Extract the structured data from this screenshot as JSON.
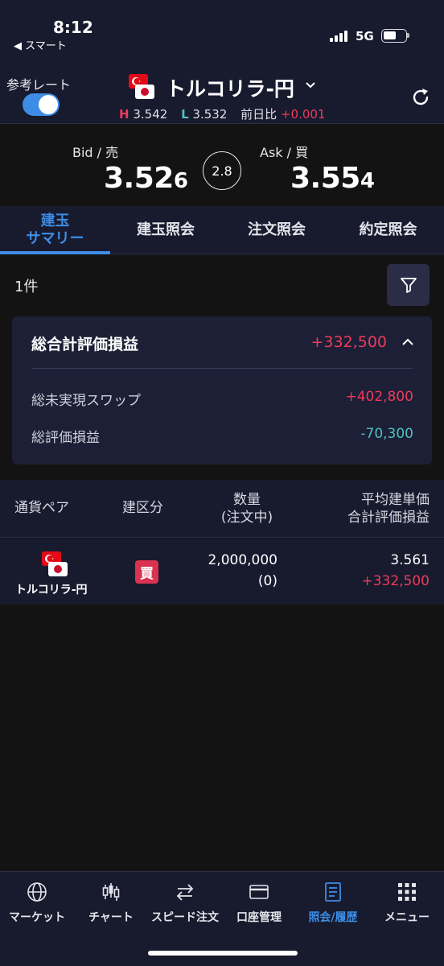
{
  "status_bar": {
    "time": "8:12",
    "back_app": "◀ スマート",
    "network": "5G"
  },
  "header": {
    "ref_rate_label": "参考レート",
    "ref_rate_enabled": true,
    "pair_name": "トルコリラ-円",
    "high_label": "H",
    "high_value": "3.542",
    "low_label": "L",
    "low_value": "3.532",
    "change_label": "前日比",
    "change_value": "+0.001"
  },
  "prices": {
    "bid_label": "Bid / 売",
    "bid_main": "3.52",
    "bid_pip": "6",
    "spread": "2.8",
    "ask_label": "Ask / 買",
    "ask_main": "3.55",
    "ask_pip": "4"
  },
  "tabs": [
    {
      "label": "建玉\nサマリー",
      "active": true
    },
    {
      "label": "建玉照会",
      "active": false
    },
    {
      "label": "注文照会",
      "active": false
    },
    {
      "label": "約定照会",
      "active": false
    }
  ],
  "summary": {
    "count": "1件",
    "title": "総合計評価損益",
    "total": "+332,500",
    "rows": [
      {
        "label": "総未実現スワップ",
        "value": "+402,800",
        "sign": "pos"
      },
      {
        "label": "総評価損益",
        "value": "-70,300",
        "sign": "neg"
      }
    ]
  },
  "table": {
    "headers": {
      "pair": "通貨ペア",
      "side": "建区分",
      "qty_line1": "数量",
      "qty_line2": "(注文中)",
      "avg_line1": "平均建単価",
      "avg_line2": "合計評価損益"
    },
    "rows": [
      {
        "pair": "トルコリラ-円",
        "side": "買",
        "quantity": "2,000,000",
        "pending": "(0)",
        "avg_price": "3.561",
        "pnl": "+332,500"
      }
    ]
  },
  "bottom_nav": [
    {
      "label": "マーケット",
      "icon": "globe-icon",
      "active": false
    },
    {
      "label": "チャート",
      "icon": "candlestick-icon",
      "active": false
    },
    {
      "label": "スピード注文",
      "icon": "swap-arrows-icon",
      "active": false
    },
    {
      "label": "口座管理",
      "icon": "card-icon",
      "active": false
    },
    {
      "label": "照会/履歴",
      "icon": "document-icon",
      "active": true
    },
    {
      "label": "メニュー",
      "icon": "grid-menu-icon",
      "active": false
    }
  ],
  "colors": {
    "accent": "#3d8de6",
    "positive": "#ee3b5b",
    "negative": "#4ec0c2",
    "panel": "#181a2e",
    "background": "#131313"
  }
}
